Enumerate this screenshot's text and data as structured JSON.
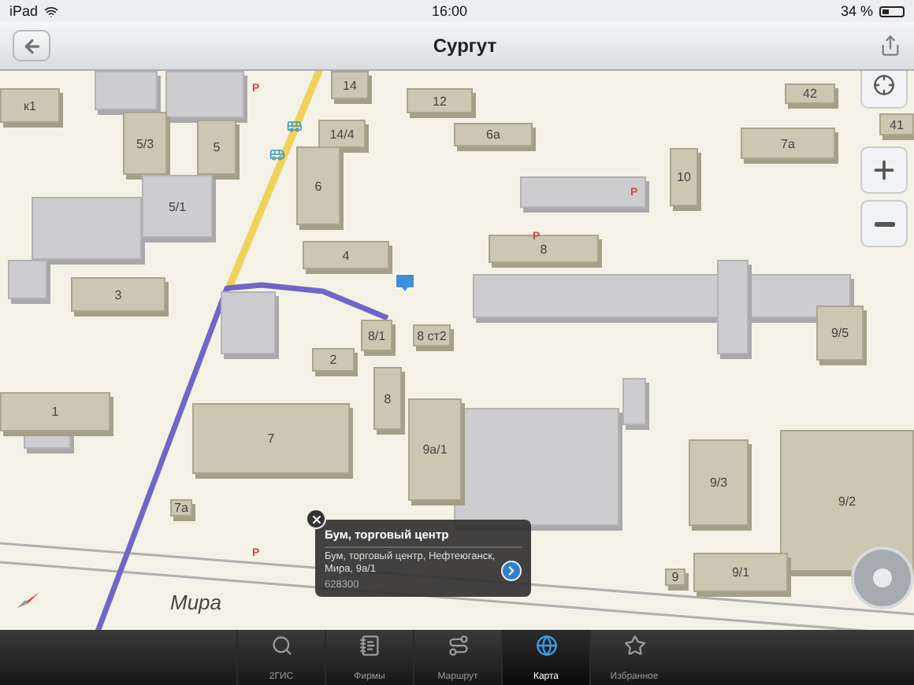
{
  "status_bar": {
    "device": "iPad",
    "time": "16:00",
    "battery": "34 %"
  },
  "nav_bar": {
    "title": "Сургут"
  },
  "map": {
    "buildings": [
      {
        "label": "к1"
      },
      {
        "label": "5/3"
      },
      {
        "label": "5"
      },
      {
        "label": "14"
      },
      {
        "label": "14/4"
      },
      {
        "label": "12"
      },
      {
        "label": "6"
      },
      {
        "label": "6а"
      },
      {
        "label": "5/1"
      },
      {
        "label": "4"
      },
      {
        "label": "3"
      },
      {
        "label": "8/1"
      },
      {
        "label": "8 ст2"
      },
      {
        "label": "2"
      },
      {
        "label": "1"
      },
      {
        "label": "7"
      },
      {
        "label": "8"
      },
      {
        "label": "9а/1"
      },
      {
        "label": "7а"
      },
      {
        "label": "10"
      },
      {
        "label": "8"
      },
      {
        "label": "7а"
      },
      {
        "label": "42"
      },
      {
        "label": "41"
      },
      {
        "label": "9/5"
      },
      {
        "label": "9/3"
      },
      {
        "label": "9/2"
      },
      {
        "label": "9/1"
      },
      {
        "label": "9"
      }
    ],
    "parking_signs": [
      "P",
      "P",
      "P",
      "P"
    ],
    "street_label": "Мира",
    "popup": {
      "title": "Бум, торговый центр",
      "address": "Бум, торговый центр, Нефтеюганск, Мира, 9а/1",
      "postcode": "628300"
    }
  },
  "tab_bar": {
    "tabs": [
      {
        "label": "2ГИС",
        "selected": false
      },
      {
        "label": "Фирмы",
        "selected": false
      },
      {
        "label": "Маршрут",
        "selected": false
      },
      {
        "label": "Карта",
        "selected": true
      },
      {
        "label": "Избранное",
        "selected": false
      }
    ]
  }
}
